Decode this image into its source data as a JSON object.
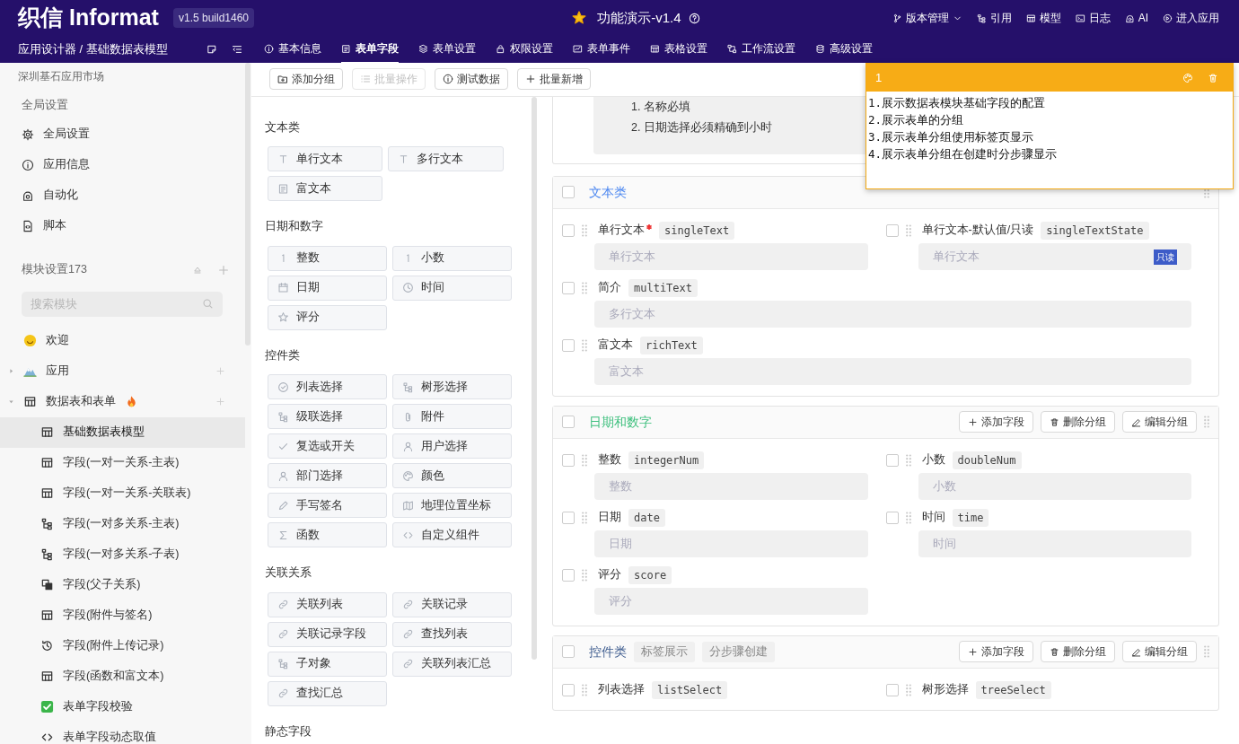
{
  "header": {
    "logo": "织信 Informat",
    "version": "v1.5 build1460",
    "app_title": "功能演示-v1.4",
    "menu": [
      {
        "label": "版本管理",
        "dropdown": true
      },
      {
        "label": "引用",
        "dropdown": false
      },
      {
        "label": "模型",
        "dropdown": false
      },
      {
        "label": "日志",
        "dropdown": false
      },
      {
        "label": "AI",
        "dropdown": false
      },
      {
        "label": "进入应用",
        "dropdown": false
      }
    ]
  },
  "subbar": {
    "breadcrumb": "应用设计器 / 基础数据表模型",
    "tabs": [
      {
        "label": "基本信息",
        "selected": false
      },
      {
        "label": "表单字段",
        "selected": true
      },
      {
        "label": "表单设置",
        "selected": false
      },
      {
        "label": "权限设置",
        "selected": false
      },
      {
        "label": "表单事件",
        "selected": false
      },
      {
        "label": "表格设置",
        "selected": false
      },
      {
        "label": "工作流设置",
        "selected": false
      },
      {
        "label": "高级设置",
        "selected": false
      }
    ]
  },
  "sidebar": {
    "market": "深圳基石应用市场",
    "global_heading": "全局设置",
    "global_items": [
      "全局设置",
      "应用信息",
      "自动化",
      "脚本"
    ],
    "module_heading": "模块设置173",
    "search": {
      "placeholder": "搜索模块"
    },
    "tree": [
      {
        "label": "欢迎",
        "selected": false
      },
      {
        "label": "应用",
        "selected": false,
        "expanded": false
      },
      {
        "label": "数据表和表单",
        "selected": false,
        "expanded": true,
        "children": [
          {
            "label": "基础数据表模型",
            "selected": true
          },
          {
            "label": "字段(一对一关系-主表)",
            "selected": false
          },
          {
            "label": "字段(一对一关系-关联表)",
            "selected": false
          },
          {
            "label": "字段(一对多关系-主表)",
            "selected": false
          },
          {
            "label": "字段(一对多关系-子表)",
            "selected": false
          },
          {
            "label": "字段(父子关系)",
            "selected": false
          },
          {
            "label": "字段(附件与签名)",
            "selected": false
          },
          {
            "label": "字段(附件上传记录)",
            "selected": false
          },
          {
            "label": "字段(函数和富文本)",
            "selected": false
          },
          {
            "label": "表单字段校验",
            "selected": false
          },
          {
            "label": "表单字段动态取值",
            "selected": false
          }
        ]
      }
    ]
  },
  "toolbar": [
    {
      "label": "添加分组",
      "disabled": false
    },
    {
      "label": "批量操作",
      "disabled": true
    },
    {
      "label": "测试数据",
      "disabled": false
    },
    {
      "label": "批量新增",
      "disabled": false
    }
  ],
  "palette": [
    {
      "title": "文本类",
      "items": [
        "单行文本",
        "多行文本",
        "富文本"
      ]
    },
    {
      "title": "日期和数字",
      "items": [
        "整数",
        "小数",
        "日期",
        "时间",
        "评分"
      ]
    },
    {
      "title": "控件类",
      "items": [
        "列表选择",
        "树形选择",
        "级联选择",
        "附件",
        "复选或开关",
        "用户选择",
        "部门选择",
        "颜色",
        "手写签名",
        "地理位置坐标",
        "函数",
        "自定义组件"
      ]
    },
    {
      "title": "关联关系",
      "items": [
        "关联列表",
        "关联记录",
        "关联记录字段",
        "查找列表",
        "子对象",
        "关联列表汇总",
        "查找汇总"
      ]
    },
    {
      "title": "静态字段"
    }
  ],
  "intro": {
    "lines": [
      "1. 名称必填",
      "2. 日期选择必须精确到小时"
    ]
  },
  "groups": [
    {
      "title": "文本类",
      "color": "#4a86f0",
      "checked": false,
      "fields": [
        {
          "label": "单行文本",
          "required": true,
          "code": "singleText",
          "placeholder": "单行文本",
          "wide": false,
          "checked": false
        },
        {
          "label": "单行文本-默认值/只读",
          "required": false,
          "code": "singleTextState",
          "placeholder": "单行文本",
          "badge": "只读",
          "wide": false,
          "checked": false
        },
        {
          "label": "简介",
          "required": false,
          "code": "multiText",
          "placeholder": "多行文本",
          "wide": true,
          "checked": false
        },
        {
          "label": "富文本",
          "required": false,
          "code": "richText",
          "placeholder": "富文本",
          "wide": true,
          "checked": false
        }
      ]
    },
    {
      "title": "日期和数字",
      "color": "#3cbf7c",
      "checked": false,
      "buttons": [
        "添加字段",
        "删除分组",
        "编辑分组"
      ],
      "fields": [
        {
          "label": "整数",
          "required": false,
          "code": "integerNum",
          "placeholder": "整数",
          "wide": false,
          "checked": false
        },
        {
          "label": "小数",
          "required": false,
          "code": "doubleNum",
          "placeholder": "小数",
          "wide": false,
          "checked": false
        },
        {
          "label": "日期",
          "required": false,
          "code": "date",
          "placeholder": "日期",
          "wide": false,
          "checked": false
        },
        {
          "label": "时间",
          "required": false,
          "code": "time",
          "placeholder": "时间",
          "wide": false,
          "checked": false
        },
        {
          "label": "评分",
          "required": false,
          "code": "score",
          "placeholder": "评分",
          "wide": false,
          "checked": false
        }
      ]
    },
    {
      "title": "控件类",
      "color": "#3f5d8f",
      "checked": false,
      "tags": [
        "标签展示",
        "分步骤创建"
      ],
      "buttons": [
        "添加字段",
        "删除分组",
        "编辑分组"
      ],
      "fields": [
        {
          "label": "列表选择",
          "required": false,
          "code": "listSelect",
          "wide": false,
          "checked": false
        },
        {
          "label": "树形选择",
          "required": false,
          "code": "treeSelect",
          "wide": false,
          "checked": false
        }
      ]
    }
  ],
  "note": {
    "title": "1",
    "lines": [
      "1.展示数据表模块基础字段的配置",
      "2.展示表单的分组",
      "3.展示表单分组使用标签页显示",
      "4.展示表单分组在创建时分步骤显示"
    ]
  }
}
